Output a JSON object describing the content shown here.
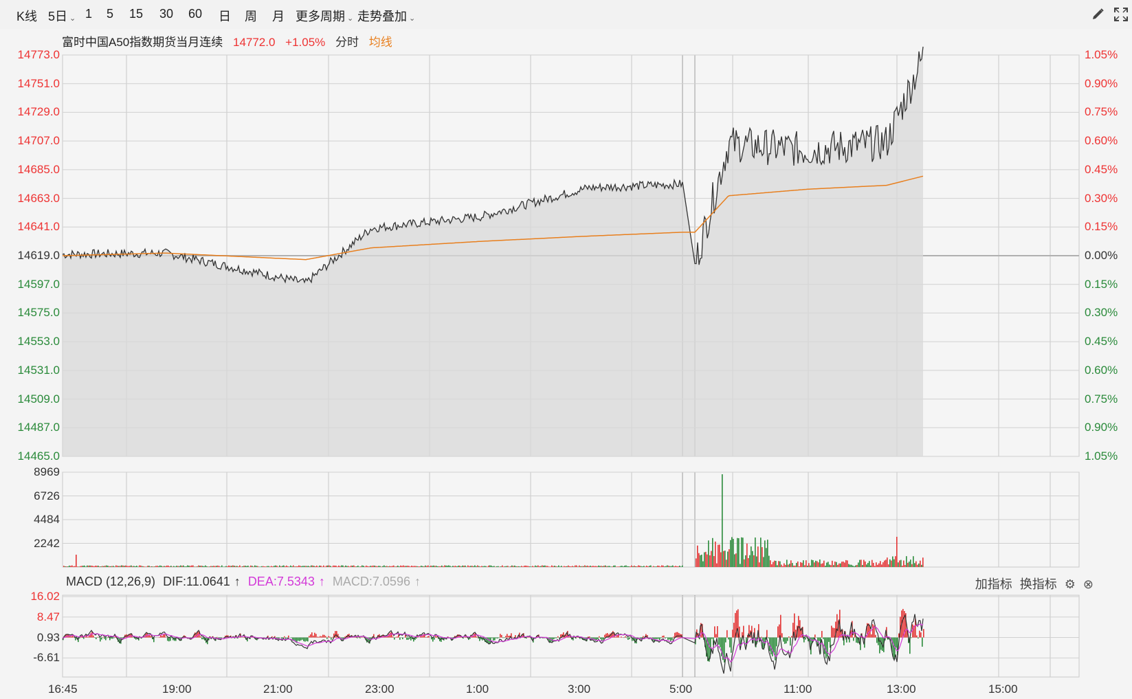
{
  "toolbar": {
    "kline": "K线",
    "period_5d": "5日",
    "p1": "1",
    "p5": "5",
    "p15": "15",
    "p30": "30",
    "p60": "60",
    "day": "日",
    "week": "周",
    "month": "月",
    "more": "更多周期",
    "overlay": "走势叠加",
    "icons": [
      "brush-icon",
      "fullscreen-icon"
    ]
  },
  "quote": {
    "name": "富时中国A50指数期货当月连续",
    "price": "14772.0",
    "change": "+1.05%",
    "mode": "分时",
    "avg": "均线"
  },
  "price_axis": {
    "left": [
      "14773.0",
      "14751.0",
      "14729.0",
      "14707.0",
      "14685.0",
      "14663.0",
      "14641.0",
      "14619.0",
      "14597.0",
      "14575.0",
      "14553.0",
      "14531.0",
      "14509.0",
      "14487.0",
      "14465.0"
    ],
    "right": [
      "1.05%",
      "0.90%",
      "0.75%",
      "0.60%",
      "0.45%",
      "0.30%",
      "0.15%",
      "0.00%",
      "0.15%",
      "0.30%",
      "0.45%",
      "0.60%",
      "0.75%",
      "0.90%",
      "1.05%"
    ]
  },
  "volume_axis": [
    "8969",
    "6726",
    "4484",
    "2242"
  ],
  "macd": {
    "name": "MACD (12,26,9)",
    "dif": "DIF:11.0641",
    "dea": "DEA:7.5343",
    "macd": "MACD:7.0596",
    "axis": [
      "16.02",
      "8.47",
      "0.93",
      "-6.61"
    ],
    "add_indicator": "加指标",
    "switch_indicator": "换指标"
  },
  "x_axis": [
    "16:45",
    "19:00",
    "21:00",
    "23:00",
    "1:00",
    "3:00",
    "5:00",
    "11:00",
    "13:00",
    "15:00"
  ],
  "colors": {
    "up": "#e33333",
    "down": "#2a8a3a",
    "avg_line": "#e87f1e",
    "price_line": "#333333",
    "dea_line": "#d33ad8"
  },
  "chart_data": {
    "type": "line",
    "title": "富时中国A50指数期货当月连续",
    "ylim": [
      14465.0,
      14773.0
    ],
    "prev_close": 14619.0,
    "x": [
      "16:45",
      "19:00",
      "21:00",
      "23:00",
      "1:00",
      "3:00",
      "5:00",
      "11:00",
      "13:00"
    ],
    "series": [
      {
        "name": "分时",
        "values": [
          14619,
          14622,
          14614,
          14640,
          14650,
          14672,
          14673,
          14700,
          14772
        ]
      },
      {
        "name": "均线",
        "values": [
          14619,
          14621,
          14615,
          14626,
          14630,
          14634,
          14637,
          14665,
          14673
        ]
      }
    ],
    "volume_ylim": [
      0,
      8969
    ],
    "macd_ylim": [
      -6.61,
      16.02
    ]
  }
}
